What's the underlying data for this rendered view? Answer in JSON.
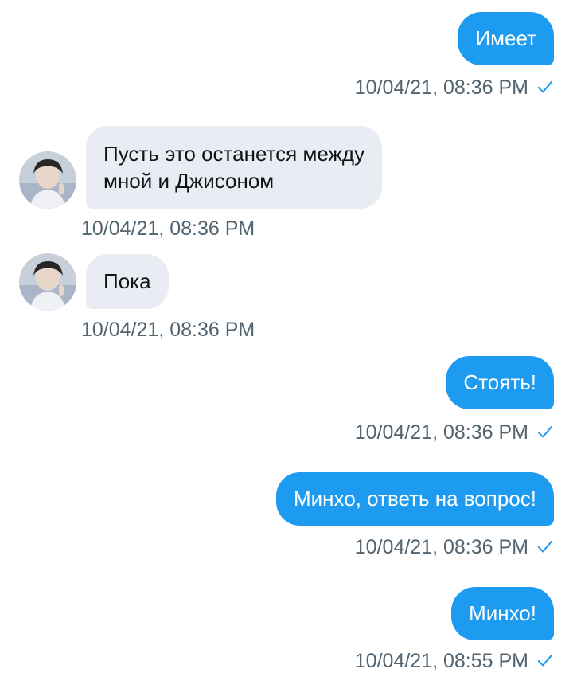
{
  "colors": {
    "outgoing_bubble": "#1d9bf0",
    "incoming_bubble": "#e9ecf3",
    "timestamp_text": "#536471",
    "read_check": "#1d9bf0"
  },
  "messages": [
    {
      "direction": "outgoing",
      "text": "Имеет",
      "timestamp": "10/04/21, 08:36 PM",
      "status_icon": "check-icon"
    },
    {
      "direction": "incoming",
      "text_line1": "Пусть это останется между",
      "text_line2": "мной и Джисоном",
      "timestamp": "10/04/21, 08:36 PM",
      "avatar": "avatar"
    },
    {
      "direction": "incoming",
      "text": "Пока",
      "timestamp": "10/04/21, 08:36 PM",
      "avatar": "avatar"
    },
    {
      "direction": "outgoing",
      "text": "Стоять!",
      "timestamp": "10/04/21, 08:36 PM",
      "status_icon": "check-icon"
    },
    {
      "direction": "outgoing",
      "text": "Минхо, ответь на вопрос!",
      "timestamp": "10/04/21, 08:36 PM",
      "status_icon": "check-icon"
    },
    {
      "direction": "outgoing",
      "text": "Минхо!",
      "timestamp": "10/04/21, 08:55 PM",
      "status_icon": "check-icon"
    }
  ]
}
